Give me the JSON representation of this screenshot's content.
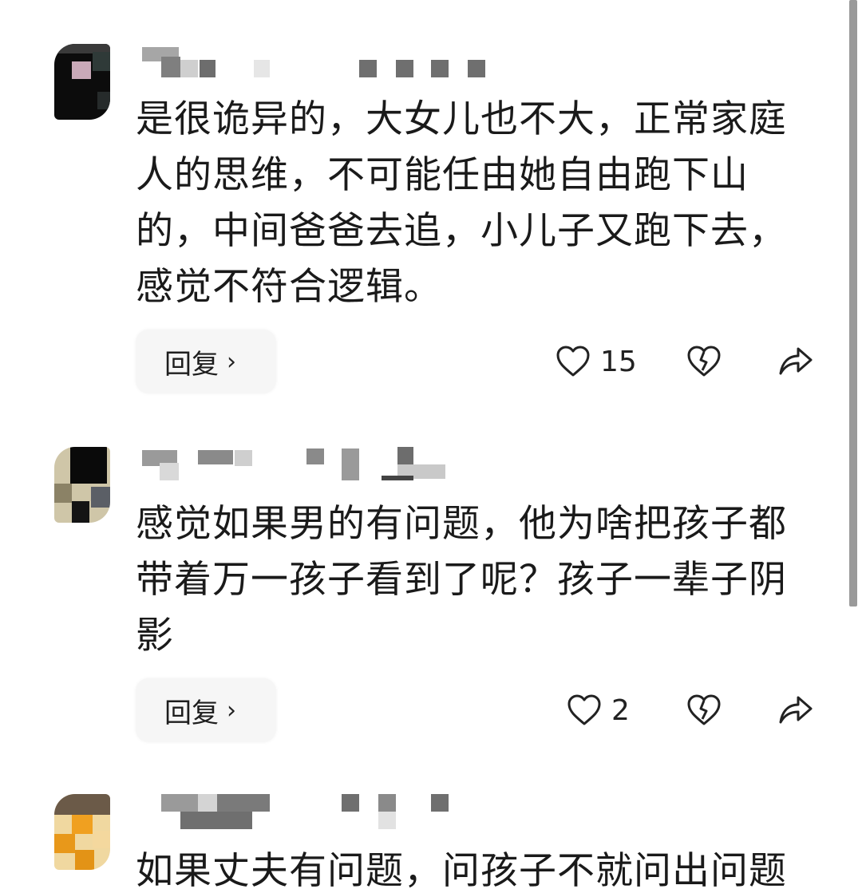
{
  "comments": [
    {
      "text": "是很诡异的，大女儿也不大，正常家庭人的思维，不可能任由她自由跑下山的，中间爸爸去追，小儿子又跑下去，感觉不符合逻辑。",
      "lines": [
        "是很诡异的，大女儿也不大，正常家庭",
        "人的思维，不可能任由她自由跑下山",
        "的，中间爸爸去追，小儿子又跑下去，",
        "感觉不符合逻辑。"
      ],
      "reply_label": "回复",
      "reply_chevron": "›",
      "like_count": "15",
      "icons": {
        "like": "heart-outline-icon",
        "dislike": "broken-heart-icon",
        "share": "share-arrow-icon"
      }
    },
    {
      "text": "感觉如果男的有问题，他为啥把孩子都带着万一孩子看到了呢？孩子一辈子阴影",
      "lines": [
        "感觉如果男的有问题，他为啥把孩子都",
        "带着万一孩子看到了呢？孩子一辈子阴",
        "影"
      ],
      "reply_label": "回复",
      "reply_chevron": "›",
      "like_count": "2",
      "icons": {
        "like": "heart-outline-icon",
        "dislike": "broken-heart-icon",
        "share": "share-arrow-icon"
      }
    },
    {
      "text": "如果丈夫有问题，问孩子不就问出问题",
      "lines": [
        "如果丈夫有问题，问孩子不就问出问题"
      ]
    }
  ],
  "colors": {
    "text": "#1a1a1a",
    "reply_bg": "#f6f6f6",
    "scrollbar": "#9a9a9a",
    "blur": "#8c8c8c"
  }
}
